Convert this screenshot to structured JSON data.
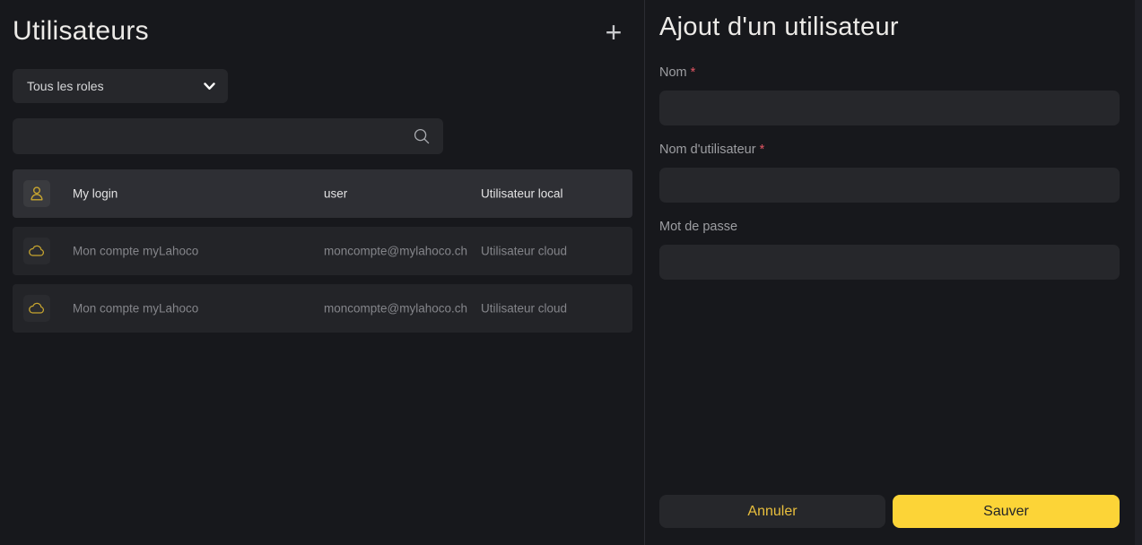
{
  "left_panel": {
    "title": "Utilisateurs",
    "add_button_icon": "plus-icon",
    "role_filter": {
      "value": "Tous les roles",
      "chevron_icon": "chevron-down-icon"
    },
    "search": {
      "value": "",
      "icon": "search-icon"
    },
    "users": [
      {
        "icon": "person-icon",
        "name": "My login",
        "login": "user",
        "type": "Utilisateur local",
        "selected": true
      },
      {
        "icon": "cloud-icon",
        "name": "Mon compte myLahoco",
        "login": "moncompte@mylahoco.ch",
        "type": "Utilisateur cloud",
        "selected": false
      },
      {
        "icon": "cloud-icon",
        "name": "Mon compte myLahoco",
        "login": "moncompte@mylahoco.ch",
        "type": "Utilisateur cloud",
        "selected": false
      }
    ]
  },
  "right_panel": {
    "title": "Ajout d'un utilisateur",
    "fields": [
      {
        "id": "nom",
        "label": "Nom",
        "required": true,
        "value": ""
      },
      {
        "id": "nom-utilisateur",
        "label": "Nom d'utilisateur",
        "required": true,
        "value": ""
      },
      {
        "id": "mot-de-passe",
        "label": "Mot de passe",
        "required": false,
        "value": ""
      }
    ],
    "buttons": {
      "cancel": "Annuler",
      "save": "Sauver"
    }
  },
  "colors": {
    "background": "#17181c",
    "divider": "#2b2c32",
    "surface": "#26272b",
    "row": "#232428",
    "row_selected": "#2e2f34",
    "accent_yellow": "#fcd437",
    "cancel_text_yellow": "#e9bf3d",
    "icon_gold": "#c7a52f",
    "required_red": "#e25563",
    "text_primary": "#eceae7",
    "text_secondary": "#84858a",
    "label_gray": "#9d9ea2"
  }
}
